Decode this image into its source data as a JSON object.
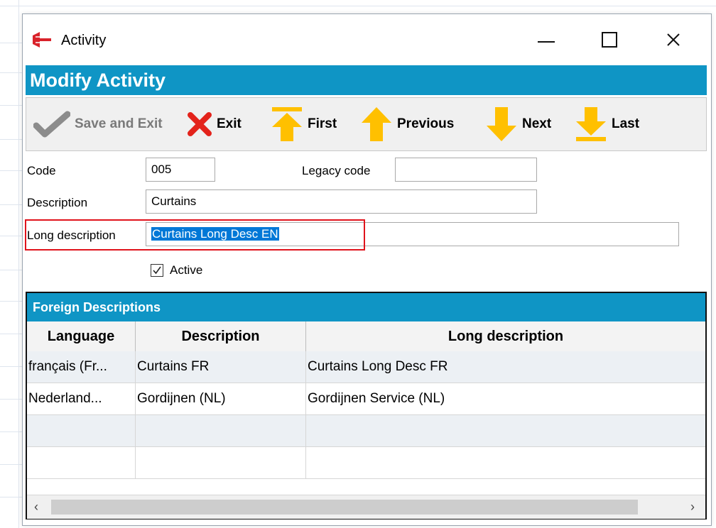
{
  "window": {
    "title": "Activity"
  },
  "header": {
    "title": "Modify Activity"
  },
  "toolbar": {
    "save_exit": "Save and Exit",
    "exit": "Exit",
    "first": "First",
    "previous": "Previous",
    "next": "Next",
    "last": "Last"
  },
  "form": {
    "code_label": "Code",
    "code_value": "005",
    "legacy_label": "Legacy code",
    "legacy_value": "",
    "description_label": "Description",
    "description_value": "Curtains",
    "long_description_label": "Long description",
    "long_description_value": "Curtains Long Desc EN",
    "active_label": "Active",
    "active_checked": true
  },
  "foreign": {
    "title": "Foreign Descriptions",
    "columns": [
      "Language",
      "Description",
      "Long description"
    ],
    "rows": [
      [
        "français (Fr...",
        "Curtains FR",
        "Curtains Long Desc FR"
      ],
      [
        "Nederland...",
        "Gordijnen (NL)",
        "Gordijnen Service (NL)"
      ],
      [
        "",
        "",
        ""
      ],
      [
        "",
        "",
        ""
      ]
    ]
  },
  "colors": {
    "accent": "#0f95c5",
    "highlight": "#e0131c",
    "arrow": "#ffc000",
    "exit": "#e3231b"
  }
}
